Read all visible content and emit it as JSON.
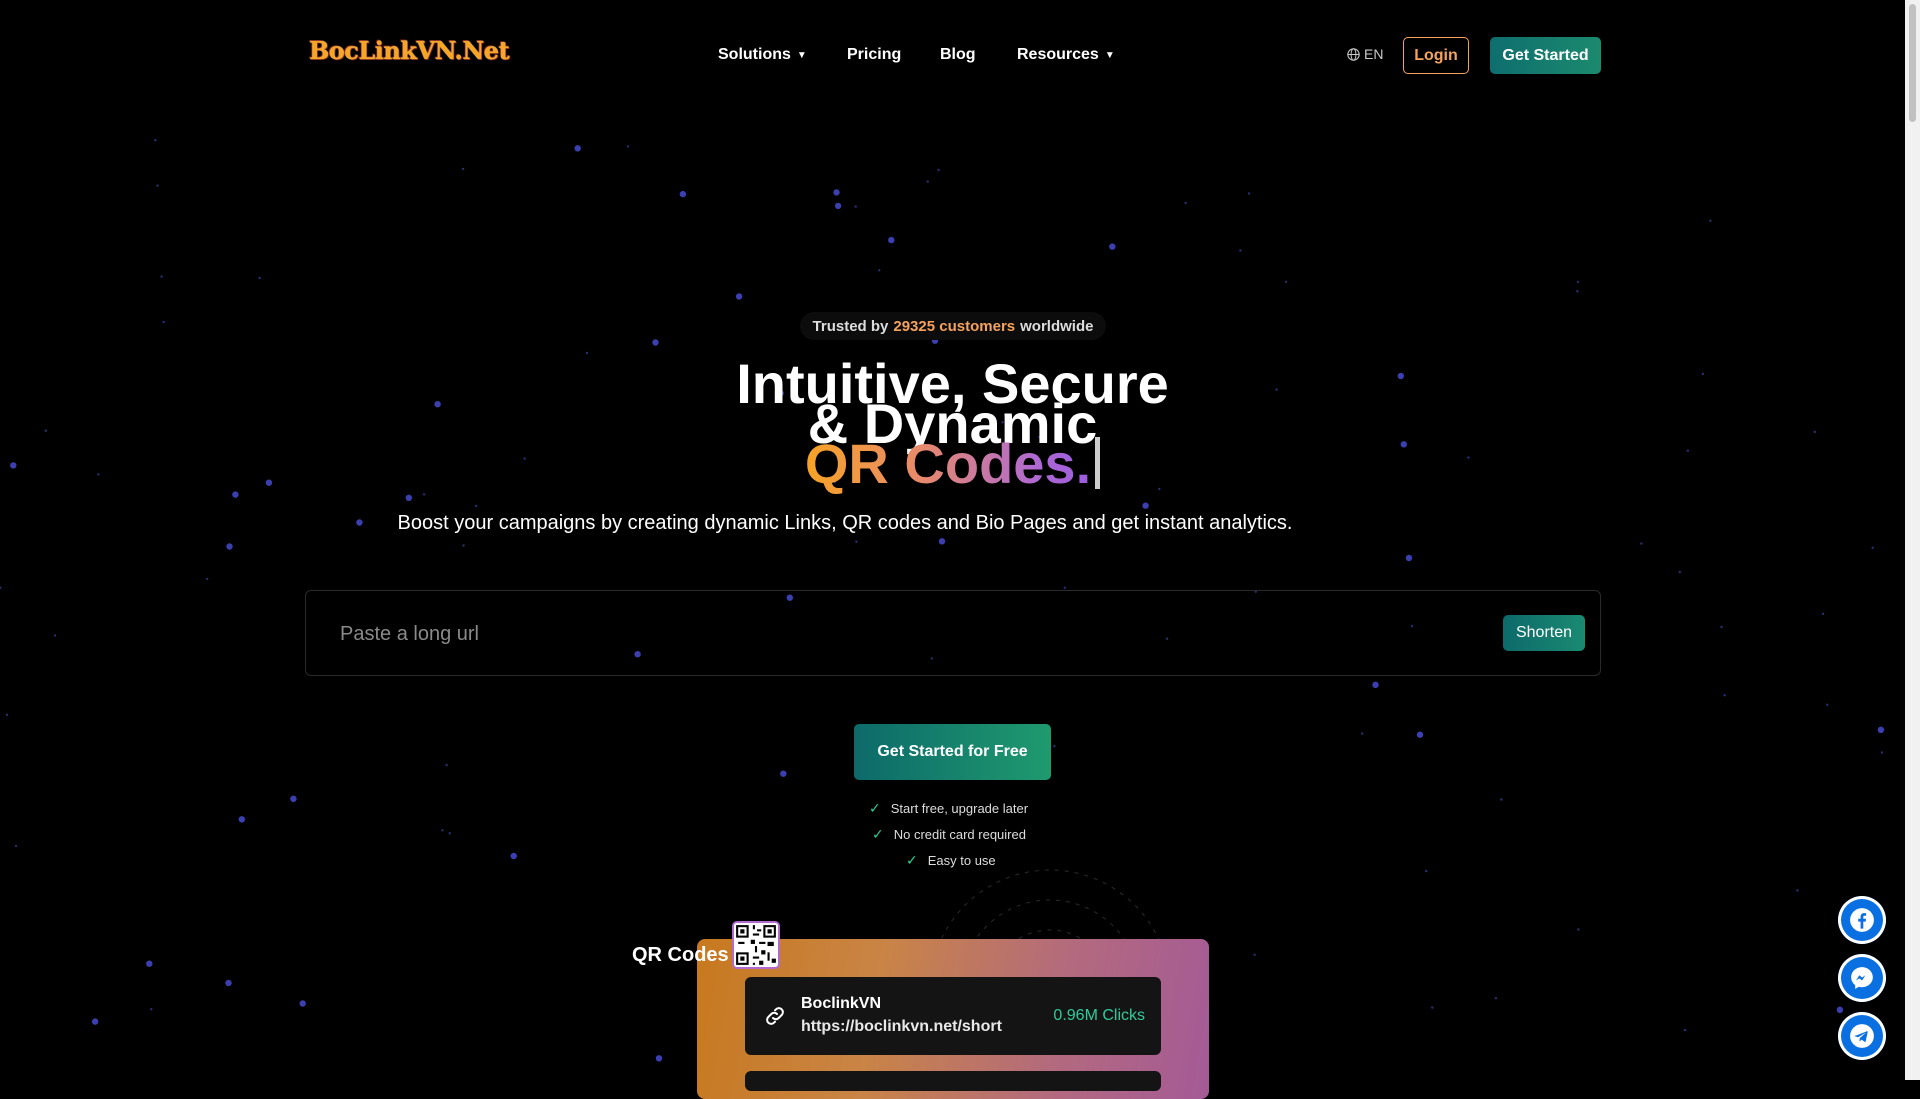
{
  "header": {
    "logo_text": "BocLinkVN.Net",
    "nav": [
      {
        "label": "Solutions",
        "dropdown": true
      },
      {
        "label": "Pricing",
        "dropdown": false
      },
      {
        "label": "Blog",
        "dropdown": false
      },
      {
        "label": "Resources",
        "dropdown": true
      }
    ],
    "lang": "EN",
    "login_label": "Login",
    "get_started_label": "Get Started"
  },
  "hero": {
    "trusted_prefix": "Trusted by",
    "trusted_count": "29325 customers",
    "trusted_suffix": "worldwide",
    "headline_line1": "Intuitive, Secure",
    "headline_line2": "& Dynamic",
    "headline_line3": "QR Codes.",
    "subtitle": "Boost your campaigns by creating dynamic Links, QR codes and Bio Pages and get instant analytics.",
    "url_placeholder": "Paste a long url",
    "shorten_label": "Shorten",
    "cta_label": "Get Started for Free",
    "checks": [
      "Start free, upgrade later",
      "No credit card required",
      "Easy to use"
    ]
  },
  "preview": {
    "section_label": "QR Codes",
    "link_name": "BoclinkVN",
    "link_url": "https://boclinkvn.net/short",
    "clicks": "0.96M Clicks"
  },
  "colors": {
    "accent_orange": "#f5a25d",
    "accent_teal": "#0e6e6e",
    "accent_green": "#2ecc9b",
    "social_blue": "#0a6fe0"
  },
  "social": [
    "facebook-icon",
    "messenger-icon",
    "telegram-icon"
  ]
}
